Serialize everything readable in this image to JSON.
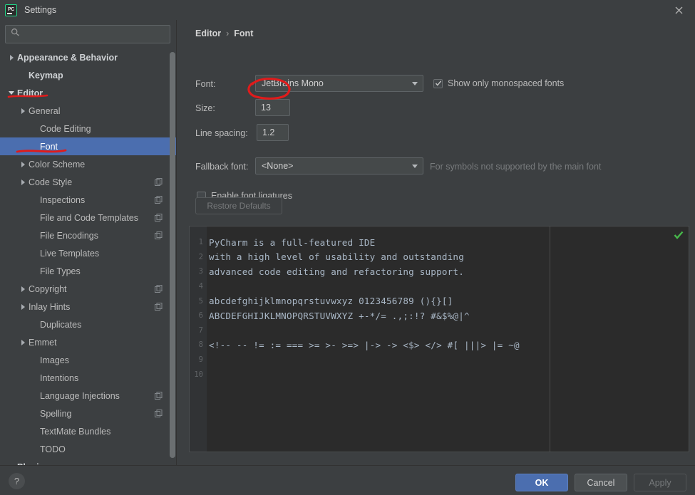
{
  "window": {
    "title": "Settings",
    "app_icon": "pycharm-icon",
    "close_icon": "close-icon"
  },
  "sidebar": {
    "search": {
      "placeholder": "",
      "value": "",
      "icon": "search-icon"
    },
    "items": [
      {
        "label": "Appearance & Behavior",
        "indent": 0,
        "arrow": "right",
        "bold": true,
        "badge": false,
        "selected": false
      },
      {
        "label": "Keymap",
        "indent": 1,
        "arrow": "none",
        "bold": true,
        "badge": false,
        "selected": false
      },
      {
        "label": "Editor",
        "indent": 0,
        "arrow": "down",
        "bold": true,
        "badge": false,
        "selected": false
      },
      {
        "label": "General",
        "indent": 1,
        "arrow": "right",
        "bold": false,
        "badge": false,
        "selected": false
      },
      {
        "label": "Code Editing",
        "indent": 2,
        "arrow": "none",
        "bold": false,
        "badge": false,
        "selected": false
      },
      {
        "label": "Font",
        "indent": 2,
        "arrow": "none",
        "bold": false,
        "badge": false,
        "selected": true
      },
      {
        "label": "Color Scheme",
        "indent": 1,
        "arrow": "right",
        "bold": false,
        "badge": false,
        "selected": false
      },
      {
        "label": "Code Style",
        "indent": 1,
        "arrow": "right",
        "bold": false,
        "badge": true,
        "selected": false
      },
      {
        "label": "Inspections",
        "indent": 2,
        "arrow": "none",
        "bold": false,
        "badge": true,
        "selected": false
      },
      {
        "label": "File and Code Templates",
        "indent": 2,
        "arrow": "none",
        "bold": false,
        "badge": true,
        "selected": false
      },
      {
        "label": "File Encodings",
        "indent": 2,
        "arrow": "none",
        "bold": false,
        "badge": true,
        "selected": false
      },
      {
        "label": "Live Templates",
        "indent": 2,
        "arrow": "none",
        "bold": false,
        "badge": false,
        "selected": false
      },
      {
        "label": "File Types",
        "indent": 2,
        "arrow": "none",
        "bold": false,
        "badge": false,
        "selected": false
      },
      {
        "label": "Copyright",
        "indent": 1,
        "arrow": "right",
        "bold": false,
        "badge": true,
        "selected": false
      },
      {
        "label": "Inlay Hints",
        "indent": 1,
        "arrow": "right",
        "bold": false,
        "badge": true,
        "selected": false
      },
      {
        "label": "Duplicates",
        "indent": 2,
        "arrow": "none",
        "bold": false,
        "badge": false,
        "selected": false
      },
      {
        "label": "Emmet",
        "indent": 1,
        "arrow": "right",
        "bold": false,
        "badge": false,
        "selected": false
      },
      {
        "label": "Images",
        "indent": 2,
        "arrow": "none",
        "bold": false,
        "badge": false,
        "selected": false
      },
      {
        "label": "Intentions",
        "indent": 2,
        "arrow": "none",
        "bold": false,
        "badge": false,
        "selected": false
      },
      {
        "label": "Language Injections",
        "indent": 2,
        "arrow": "none",
        "bold": false,
        "badge": true,
        "selected": false
      },
      {
        "label": "Spelling",
        "indent": 2,
        "arrow": "none",
        "bold": false,
        "badge": true,
        "selected": false
      },
      {
        "label": "TextMate Bundles",
        "indent": 2,
        "arrow": "none",
        "bold": false,
        "badge": false,
        "selected": false
      },
      {
        "label": "TODO",
        "indent": 2,
        "arrow": "none",
        "bold": false,
        "badge": false,
        "selected": false
      },
      {
        "label": "Plugins",
        "indent": 0,
        "arrow": "none",
        "bold": true,
        "badge": false,
        "selected": false
      }
    ]
  },
  "main": {
    "breadcrumb": {
      "parent": "Editor",
      "separator": "›",
      "current": "Font"
    },
    "font_row": {
      "label": "Font:",
      "value": "JetBrains Mono",
      "arrow_icon": "chevron-down-icon"
    },
    "monospaced_checkbox": {
      "label": "Show only monospaced fonts",
      "checked": true,
      "check_icon": "check-icon"
    },
    "size_row": {
      "label": "Size:",
      "value": "13"
    },
    "line_spacing_row": {
      "label": "Line spacing:",
      "value": "1.2"
    },
    "fallback_row": {
      "label": "Fallback font:",
      "value": "<None>",
      "hint": "For symbols not supported by the main font",
      "arrow_icon": "chevron-down-icon"
    },
    "ligatures_checkbox": {
      "label": "Enable font ligatures",
      "checked": false
    },
    "restore_button": {
      "label": "Restore Defaults",
      "enabled": false
    },
    "preview": {
      "status_icon": "green-check-icon",
      "lines": [
        {
          "n": "1",
          "text": "PyCharm is a full-featured IDE"
        },
        {
          "n": "2",
          "text": "with a high level of usability and outstanding"
        },
        {
          "n": "3",
          "text": "advanced code editing and refactoring support."
        },
        {
          "n": "4",
          "text": ""
        },
        {
          "n": "5",
          "text": "abcdefghijklmnopqrstuvwxyz 0123456789 (){}[]"
        },
        {
          "n": "6",
          "text": "ABCDEFGHIJKLMNOPQRSTUVWXYZ +-*/= .,;:!? #&$%@|^"
        },
        {
          "n": "7",
          "text": ""
        },
        {
          "n": "8",
          "text": "<!-- -- != := === >= >- >=> |-> -> <$> </> #[ |||> |= ~@"
        },
        {
          "n": "9",
          "text": ""
        },
        {
          "n": "10",
          "text": ""
        }
      ]
    }
  },
  "footer": {
    "help_button": {
      "label": "?",
      "icon": "help-icon"
    },
    "ok_button": "OK",
    "cancel_button": "Cancel",
    "apply_button": "Apply"
  },
  "annotations": {
    "color": "#e01b1b",
    "circle_target": "size-field",
    "underline_targets": [
      "editor-tree-item",
      "font-tree-item"
    ]
  },
  "colors": {
    "window_bg": "#3c3f41",
    "selection_blue": "#4b6eaf",
    "editor_bg": "#2b2b2b",
    "code_text": "#a9b7c6",
    "annotation_red": "#e01b1b",
    "accent_green": "#21d789"
  }
}
